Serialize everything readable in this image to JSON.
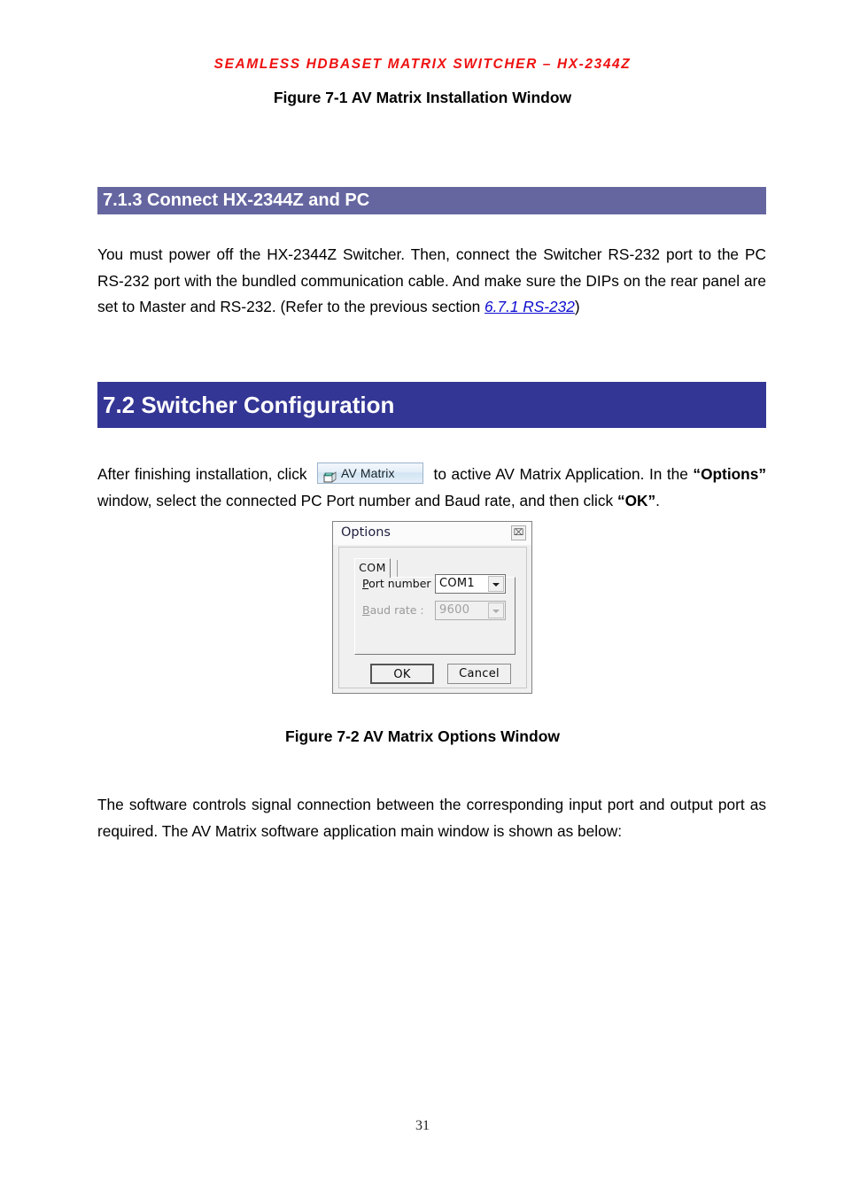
{
  "header": {
    "running_title": "SEAMLESS  HDBASET  MATRIX  SWITCHER  –  HX-2344Z"
  },
  "figures": {
    "fig1_caption": "Figure 7-1 AV Matrix Installation Window",
    "fig2_caption": "Figure 7-2 AV Matrix Options Window"
  },
  "sections": {
    "subsection_713": {
      "number_title": "7.1.3 Connect HX-2344Z and PC",
      "bar_color": "#6566A0",
      "paragraph": {
        "text_before_link": "You must power off the HX-2344Z Switcher. Then, connect the Switcher RS-232 port to the PC RS-232 port with the bundled communication cable. And make sure the DIPs on the rear panel are set to Master and RS-232. (Refer to the previous section ",
        "link_text": "6.7.1 RS-232",
        "text_after_link": ")"
      }
    },
    "section_72": {
      "number_title": "7.2 Switcher Configuration",
      "bar_color": "#343695",
      "paragraph_install": {
        "part1": "After finishing installation, click ",
        "part2": " to active AV Matrix Application. In the ",
        "options_bold": "“Options”",
        "part3": " window, select the connected PC Port number and Baud rate, and then click ",
        "ok_bold": "“OK”",
        "part4": "."
      },
      "paragraph_software": "The software controls signal connection between the corresponding input port and output port as required. The AV Matrix software application main window is shown as below:"
    }
  },
  "av_matrix_button": {
    "label": "AV Matrix",
    "icon": "av-matrix-app-icon"
  },
  "options_dialog": {
    "title": "Options",
    "close_glyph": "⌧",
    "tab": {
      "label": "COM"
    },
    "fields": [
      {
        "label_accel": "P",
        "label_rest": "ort number :",
        "value": "COM1",
        "enabled": true
      },
      {
        "label_accel": "B",
        "label_rest": "aud rate :",
        "value": "9600",
        "enabled": false
      }
    ],
    "buttons": {
      "ok": "OK",
      "cancel": "Cancel"
    }
  },
  "footer": {
    "page_number": "31"
  }
}
